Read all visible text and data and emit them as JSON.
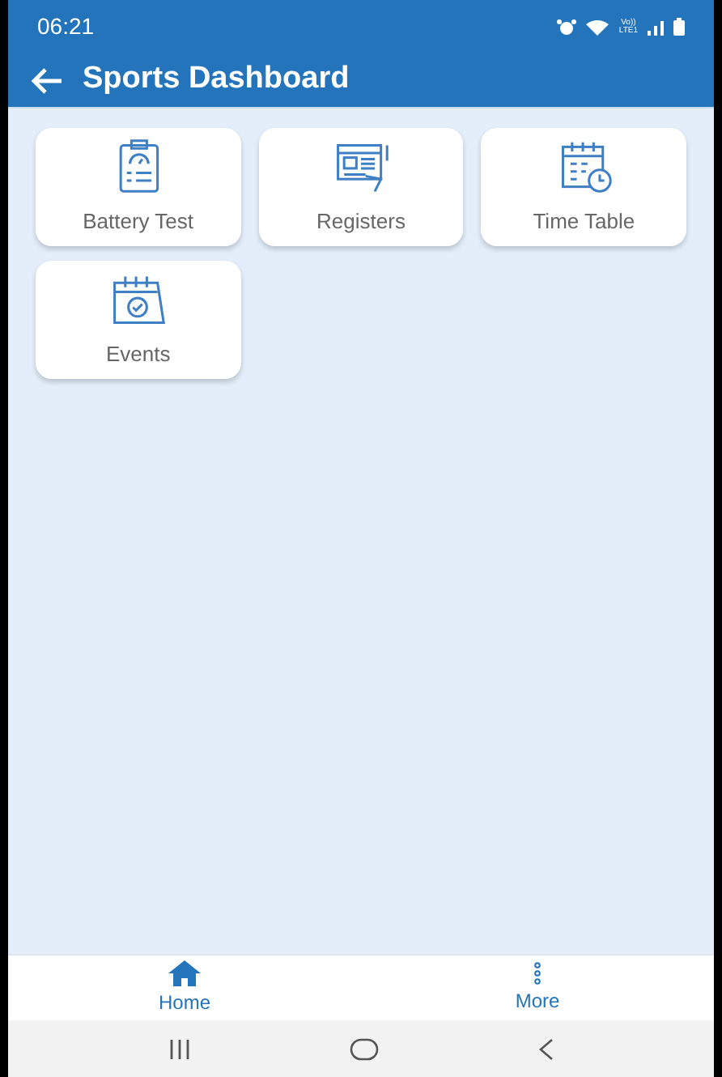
{
  "status_bar": {
    "time": "06:21",
    "network_label": "Vo))\nLTE1"
  },
  "app_bar": {
    "title": "Sports Dashboard"
  },
  "tiles": [
    {
      "label": "Battery Test",
      "kind": "clipboard"
    },
    {
      "label": "Registers",
      "kind": "register"
    },
    {
      "label": "Time Table",
      "kind": "timetable"
    },
    {
      "label": "Events",
      "kind": "calendar"
    }
  ],
  "bottom_nav": [
    {
      "label": "Home",
      "kind": "home"
    },
    {
      "label": "More",
      "kind": "more"
    }
  ]
}
